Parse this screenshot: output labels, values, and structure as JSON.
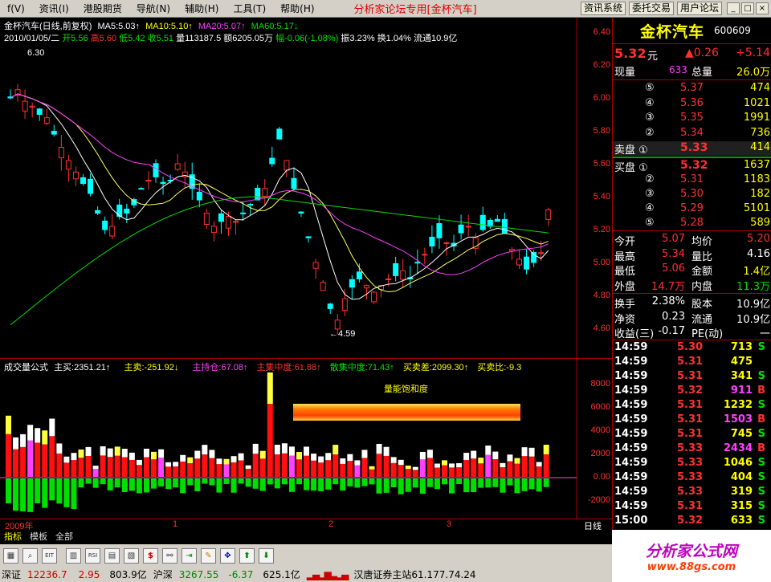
{
  "menu": {
    "items": [
      "f(V)",
      "资讯(I)",
      "港股期货",
      "导航(N)",
      "辅助(H)",
      "工具(T)",
      "帮助(H)"
    ],
    "title": "分析家论坛专用[金杯汽车]",
    "buttons": [
      "资讯系统",
      "委托交易",
      "用户论坛"
    ],
    "window_controls": [
      "_",
      "□",
      "×"
    ]
  },
  "header": {
    "line1": {
      "name": "金杯汽车(日线,前复权)",
      "ma5": "MA5:5.03↑",
      "ma10": "MA10:5.10↑",
      "ma20": "MA20:5.07↑",
      "ma60": "MA60:5.17↓"
    },
    "line2": {
      "date": "2010/01/05/二",
      "open": "开5.56",
      "high": "高5.60",
      "low": "低5.42",
      "close": "收5.51",
      "volume": "量113187.5",
      "amount": "额6205.05万",
      "change": "幅-0.06(-1.08%)",
      "amplitude": "振3.23%",
      "turnover": "换1.04%",
      "float": "流通10.9亿"
    }
  },
  "price_axis": [
    "6.40",
    "6.20",
    "6.00",
    "5.80",
    "5.60",
    "5.40",
    "5.20",
    "5.00",
    "4.80",
    "4.60"
  ],
  "annotations": {
    "high": "6.30",
    "low": "←4.59"
  },
  "sub_header": {
    "name": "成交量公式",
    "buy": "主买:2351.21↑",
    "sell": "主卖:-251.92↓",
    "hold": "主持仓:67.08↑",
    "main_conc": "主集中度:61.88↑",
    "retail_conc": "散集中度:71.43↑",
    "diff": "买卖差:2099.30↑",
    "ratio": "买卖比:-9.3"
  },
  "sub_axis": [
    "8000",
    "6000",
    "4000",
    "2000",
    "0.00",
    "-2000"
  ],
  "sub_label": "量能饱和度",
  "date_bar": {
    "year": "2009年",
    "m1": "1",
    "m2": "2",
    "m3": "3",
    "mode": "日线"
  },
  "tabs": [
    "指标",
    "模板",
    "全部"
  ],
  "toolbar_icons": [
    "chart-icon",
    "zoom-icon",
    "eit-icon",
    "kline-icon",
    "rsi-icon",
    "grid-icon",
    "table-icon",
    "dollar-icon",
    "link-icon",
    "export-icon",
    "pencil-icon",
    "arrows-icon",
    "up-arrow-icon",
    "down-arrow-icon"
  ],
  "status": {
    "sz_label": "深证",
    "sz_index": "12236.7",
    "sz_change": "2.95",
    "sz_amount": "803.9亿",
    "hs_label": "沪深",
    "hs_index": "3267.55",
    "hs_change": "-6.37",
    "hs_amount": "625.1亿",
    "server": "汉唐证券主站61.177.74.24"
  },
  "quote": {
    "name": "金杯汽车",
    "code": "600609",
    "price": "5.32",
    "unit": "元",
    "change": "▲0.26",
    "change_pct": "+5.14",
    "now_vol_label": "现量",
    "now_vol": "633",
    "total_vol_label": "总量",
    "total_vol": "26.0万",
    "asks": [
      {
        "level": "⑤",
        "price": "5.37",
        "vol": "474"
      },
      {
        "level": "④",
        "price": "5.36",
        "vol": "1021"
      },
      {
        "level": "③",
        "price": "5.35",
        "vol": "1991"
      },
      {
        "level": "②",
        "price": "5.34",
        "vol": "736"
      },
      {
        "level": "卖盘 ①",
        "price": "5.33",
        "vol": "414"
      }
    ],
    "bids": [
      {
        "level": "买盘 ①",
        "price": "5.32",
        "vol": "1637"
      },
      {
        "level": "②",
        "price": "5.31",
        "vol": "1183"
      },
      {
        "level": "③",
        "price": "5.30",
        "vol": "182"
      },
      {
        "level": "④",
        "price": "5.29",
        "vol": "5101"
      },
      {
        "level": "⑤",
        "price": "5.28",
        "vol": "589"
      }
    ],
    "stats": [
      {
        "l1": "今开",
        "v1": "5.07",
        "l2": "均价",
        "v2": "5.20"
      },
      {
        "l1": "最高",
        "v1": "5.34",
        "l2": "量比",
        "v2": "4.16"
      },
      {
        "l1": "最低",
        "v1": "5.06",
        "l2": "金额",
        "v2": "1.4亿"
      },
      {
        "l1": "外盘",
        "v1": "14.7万",
        "l2": "内盘",
        "v2": "11.3万"
      }
    ],
    "fund": [
      {
        "l1": "换手",
        "v1": "2.38%",
        "l2": "股本",
        "v2": "10.9亿"
      },
      {
        "l1": "净资",
        "v1": "0.23",
        "l2": "流通",
        "v2": "10.9亿"
      },
      {
        "l1": "收益(三)",
        "v1": "-0.17",
        "l2": "PE(动)",
        "v2": "一"
      }
    ],
    "ticks": [
      {
        "t": "14:59",
        "p": "5.30",
        "v": "713",
        "s": "S"
      },
      {
        "t": "14:59",
        "p": "5.31",
        "v": "475",
        "s": ""
      },
      {
        "t": "14:59",
        "p": "5.31",
        "v": "341",
        "s": "S"
      },
      {
        "t": "14:59",
        "p": "5.32",
        "v": "911",
        "s": "B"
      },
      {
        "t": "14:59",
        "p": "5.31",
        "v": "1232",
        "s": "S"
      },
      {
        "t": "14:59",
        "p": "5.31",
        "v": "1503",
        "s": "B"
      },
      {
        "t": "14:59",
        "p": "5.31",
        "v": "745",
        "s": "S"
      },
      {
        "t": "14:59",
        "p": "5.33",
        "v": "2434",
        "s": "B"
      },
      {
        "t": "14:59",
        "p": "5.33",
        "v": "1046",
        "s": "S"
      },
      {
        "t": "14:59",
        "p": "5.33",
        "v": "404",
        "s": "S"
      },
      {
        "t": "14:59",
        "p": "5.33",
        "v": "319",
        "s": "S"
      },
      {
        "t": "14:59",
        "p": "5.31",
        "v": "315",
        "s": "S"
      },
      {
        "t": "15:00",
        "p": "5.32",
        "v": "633",
        "s": "S"
      }
    ]
  },
  "logo": {
    "text": "分析家公式网",
    "url": "www.88gs.com"
  },
  "colors": {
    "up": "#ff3030",
    "down": "#00ffff",
    "ma5": "#ffffff",
    "ma10": "#ffff60",
    "ma20": "#ff40ff",
    "ma60": "#00e000"
  }
}
